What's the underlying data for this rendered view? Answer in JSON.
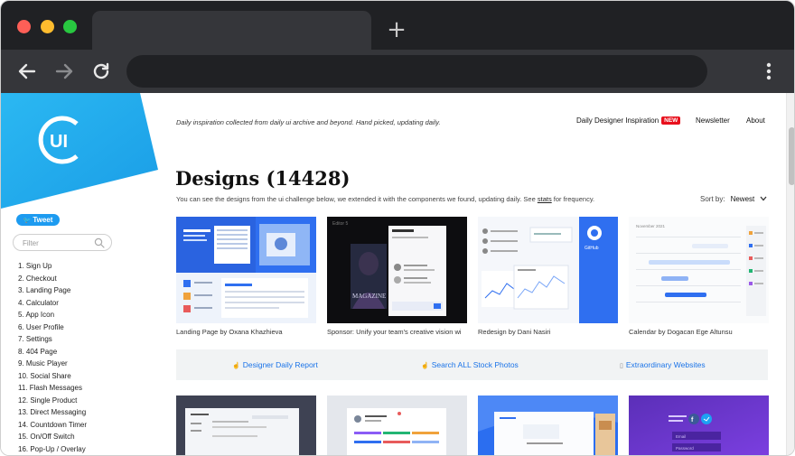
{
  "browser": {
    "new_tab_symbol": "+"
  },
  "sidebar": {
    "tweet_label": "Tweet",
    "filter_placeholder": "Filter",
    "items": [
      "1. Sign Up",
      "2. Checkout",
      "3. Landing Page",
      "4. Calculator",
      "5. App Icon",
      "6. User Profile",
      "7. Settings",
      "8. 404 Page",
      "9. Music Player",
      "10. Social Share",
      "11. Flash Messages",
      "12. Single Product",
      "13. Direct Messaging",
      "14. Countdown Timer",
      "15. On/Off Switch",
      "16. Pop-Up / Overlay"
    ]
  },
  "header": {
    "tagline": "Daily inspiration collected from daily ui archive and beyond. Hand picked, updating daily.",
    "nav": {
      "inspiration": "Daily Designer Inspiration",
      "new_badge": "NEW",
      "newsletter": "Newsletter",
      "about": "About"
    }
  },
  "main": {
    "title": "Designs (14428)",
    "subtitle_before": "You can see the designs from the ui challenge below, we extended it with the components we found, updating daily. See",
    "subtitle_link": "stats",
    "subtitle_after": "for frequency.",
    "sort_label": "Sort by:",
    "sort_value": "Newest",
    "cards": [
      {
        "caption": "Landing Page by Oxana Khazhieva"
      },
      {
        "caption": "Sponsor: Unify your team's creative vision wi"
      },
      {
        "caption": "Redesign by Dani Nasiri"
      },
      {
        "caption": "Calendar by Dogacan Ege Altunsu"
      }
    ],
    "links": {
      "report": "Designer Daily Report",
      "stock": "Search ALL Stock Photos",
      "websites": "Extraordinary Websites"
    },
    "card2_texts": {
      "social_email": "Email",
      "social_password": "Password"
    },
    "thumb_texts": {
      "magazine": "MAGAZINE",
      "editor": "Editor 5",
      "github": "GitHub",
      "calendar_month": "November 2021"
    }
  }
}
